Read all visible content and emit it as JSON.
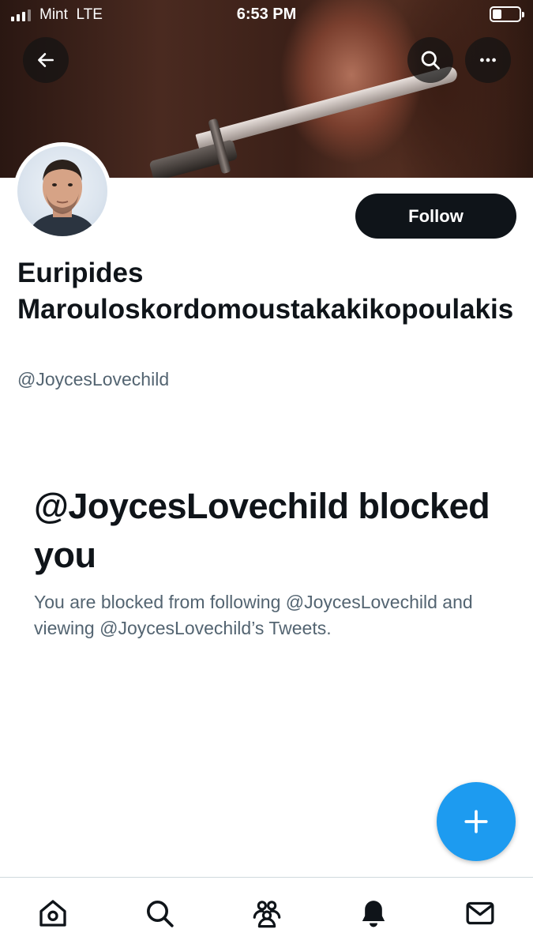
{
  "status_bar": {
    "carrier": "Mint",
    "network": "LTE",
    "time": "6:53 PM",
    "battery_level": 0.35
  },
  "header": {
    "icons": [
      "back-arrow-icon",
      "search-icon",
      "more-icon"
    ]
  },
  "profile": {
    "follow_label": "Follow",
    "display_name": "Euripides Marouloskordomoustakakikopoulakis",
    "handle": "@JoycesLovechild"
  },
  "blocked": {
    "title": "@JoycesLovechild blocked you",
    "description": "You are blocked from following @JoycesLovechild and viewing @JoycesLovechild’s Tweets."
  },
  "fab": {
    "icon": "plus-icon"
  },
  "tabbar": {
    "items": [
      {
        "icon": "home-icon"
      },
      {
        "icon": "search-icon"
      },
      {
        "icon": "communities-icon"
      },
      {
        "icon": "notifications-icon"
      },
      {
        "icon": "messages-icon"
      }
    ]
  },
  "colors": {
    "accent": "#1d9bf0",
    "text_primary": "#0f1419",
    "text_secondary": "#536471",
    "border": "#cfd9de"
  }
}
